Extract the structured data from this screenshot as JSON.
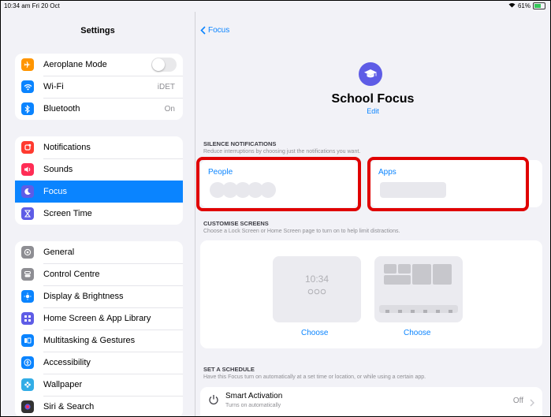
{
  "status_bar": {
    "time": "10:34 am  Fri 20 Oct",
    "battery": "61%"
  },
  "sidebar": {
    "title": "Settings",
    "group1": [
      {
        "label": "Aeroplane Mode",
        "icon": "airplane-icon",
        "color": "#ff9500",
        "value": "",
        "toggle": true
      },
      {
        "label": "Wi-Fi",
        "icon": "wifi-icon",
        "color": "#0a84ff",
        "value": "iDET"
      },
      {
        "label": "Bluetooth",
        "icon": "bluetooth-icon",
        "color": "#0a84ff",
        "value": "On"
      }
    ],
    "group2": [
      {
        "label": "Notifications",
        "icon": "bell-icon",
        "color": "#ff3b30"
      },
      {
        "label": "Sounds",
        "icon": "speaker-icon",
        "color": "#ff2d55"
      },
      {
        "label": "Focus",
        "icon": "moon-icon",
        "color": "#5e5ce6",
        "selected": true
      },
      {
        "label": "Screen Time",
        "icon": "hourglass-icon",
        "color": "#5e5ce6"
      }
    ],
    "group3": [
      {
        "label": "General",
        "icon": "gear-icon",
        "color": "#8e8e93"
      },
      {
        "label": "Control Centre",
        "icon": "switches-icon",
        "color": "#8e8e93"
      },
      {
        "label": "Display & Brightness",
        "icon": "sun-icon",
        "color": "#0a84ff"
      },
      {
        "label": "Home Screen & App Library",
        "icon": "grid-icon",
        "color": "#5e5ce6"
      },
      {
        "label": "Multitasking & Gestures",
        "icon": "multitask-icon",
        "color": "#0a84ff"
      },
      {
        "label": "Accessibility",
        "icon": "accessibility-icon",
        "color": "#0a84ff"
      },
      {
        "label": "Wallpaper",
        "icon": "flower-icon",
        "color": "#32ade6"
      },
      {
        "label": "Siri & Search",
        "icon": "siri-icon",
        "color": "#333333"
      }
    ]
  },
  "main": {
    "back_label": "Focus",
    "title": "School Focus",
    "edit_label": "Edit",
    "silence": {
      "header": "SILENCE NOTIFICATIONS",
      "sub": "Reduce interruptions by choosing just the notifications you want.",
      "people_label": "People",
      "apps_label": "Apps"
    },
    "customise": {
      "header": "CUSTOMISE SCREENS",
      "sub": "Choose a Lock Screen or Home Screen page to turn on to help limit distractions.",
      "lock_time": "10:34",
      "choose_lock": "Choose",
      "choose_home": "Choose"
    },
    "schedule": {
      "header": "SET A SCHEDULE",
      "sub": "Have this Focus turn on automatically at a set time or location, or while using a certain app.",
      "smart_title": "Smart Activation",
      "smart_sub": "Turns on automatically",
      "smart_value": "Off"
    }
  }
}
